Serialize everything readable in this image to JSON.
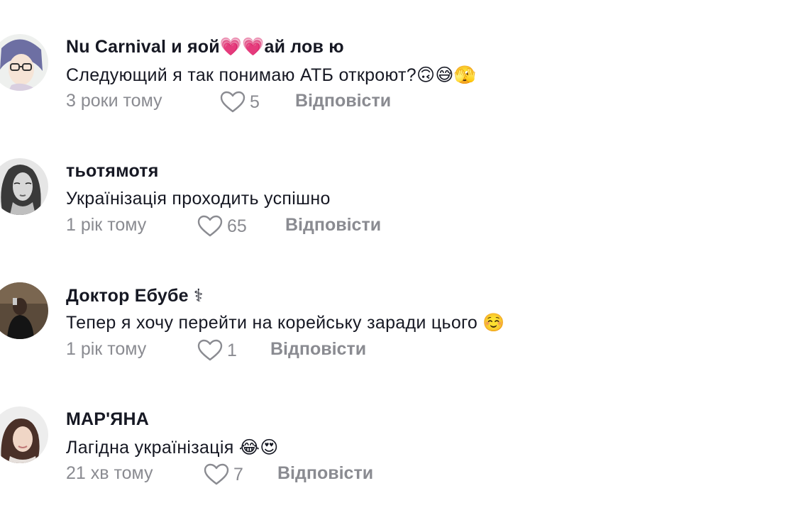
{
  "comments": [
    {
      "username": "Nu Carnival и яой💗💗ай лов ю",
      "text": "Следующий я так понимаю АТБ откроют?🙃😅🫣",
      "time": "3 роки тому",
      "likes": "5",
      "reply_label": "Відповісти",
      "avatar": "anime-avatar"
    },
    {
      "username": "тьотямотя",
      "text": "Українізація проходить успішно",
      "time": "1 рік тому",
      "likes": "65",
      "reply_label": "Відповісти",
      "avatar": "bw-portrait-avatar"
    },
    {
      "username": "Доктор Ебубе ⚕",
      "text": "Тепер я хочу перейти на корейську заради цього ☺️",
      "time": "1 рік тому",
      "likes": "1",
      "reply_label": "Відповісти",
      "avatar": "dark-photo-avatar"
    },
    {
      "username": "МАР'ЯНА",
      "text": "Лагідна українізація 😂😍",
      "time": "21 хв тому",
      "likes": "7",
      "reply_label": "Відповісти",
      "avatar": "selfie-avatar"
    }
  ],
  "colors": {
    "text": "#161823",
    "meta": "#8a8b91",
    "background": "#ffffff"
  },
  "icons": {
    "like": "heart-outline-icon"
  }
}
